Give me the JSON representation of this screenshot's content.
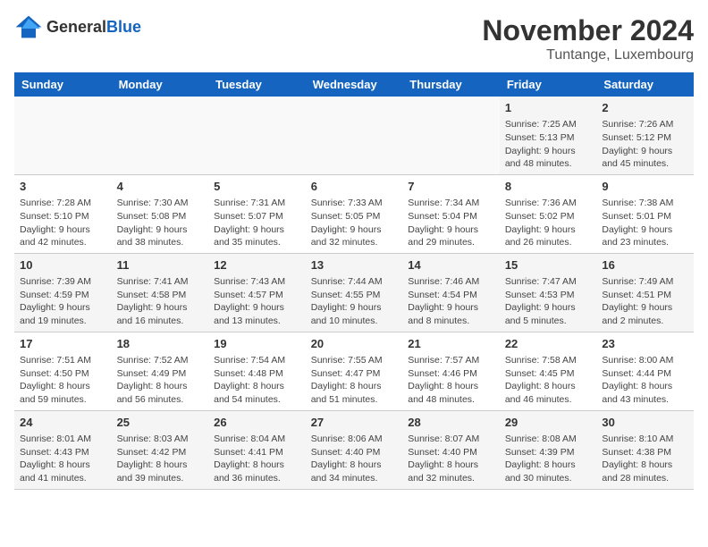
{
  "header": {
    "logo_general": "General",
    "logo_blue": "Blue",
    "month_title": "November 2024",
    "location": "Tuntange, Luxembourg"
  },
  "days_of_week": [
    "Sunday",
    "Monday",
    "Tuesday",
    "Wednesday",
    "Thursday",
    "Friday",
    "Saturday"
  ],
  "weeks": [
    [
      {
        "day": "",
        "sunrise": "",
        "sunset": "",
        "daylight": ""
      },
      {
        "day": "",
        "sunrise": "",
        "sunset": "",
        "daylight": ""
      },
      {
        "day": "",
        "sunrise": "",
        "sunset": "",
        "daylight": ""
      },
      {
        "day": "",
        "sunrise": "",
        "sunset": "",
        "daylight": ""
      },
      {
        "day": "",
        "sunrise": "",
        "sunset": "",
        "daylight": ""
      },
      {
        "day": "1",
        "sunrise": "Sunrise: 7:25 AM",
        "sunset": "Sunset: 5:13 PM",
        "daylight": "Daylight: 9 hours and 48 minutes."
      },
      {
        "day": "2",
        "sunrise": "Sunrise: 7:26 AM",
        "sunset": "Sunset: 5:12 PM",
        "daylight": "Daylight: 9 hours and 45 minutes."
      }
    ],
    [
      {
        "day": "3",
        "sunrise": "Sunrise: 7:28 AM",
        "sunset": "Sunset: 5:10 PM",
        "daylight": "Daylight: 9 hours and 42 minutes."
      },
      {
        "day": "4",
        "sunrise": "Sunrise: 7:30 AM",
        "sunset": "Sunset: 5:08 PM",
        "daylight": "Daylight: 9 hours and 38 minutes."
      },
      {
        "day": "5",
        "sunrise": "Sunrise: 7:31 AM",
        "sunset": "Sunset: 5:07 PM",
        "daylight": "Daylight: 9 hours and 35 minutes."
      },
      {
        "day": "6",
        "sunrise": "Sunrise: 7:33 AM",
        "sunset": "Sunset: 5:05 PM",
        "daylight": "Daylight: 9 hours and 32 minutes."
      },
      {
        "day": "7",
        "sunrise": "Sunrise: 7:34 AM",
        "sunset": "Sunset: 5:04 PM",
        "daylight": "Daylight: 9 hours and 29 minutes."
      },
      {
        "day": "8",
        "sunrise": "Sunrise: 7:36 AM",
        "sunset": "Sunset: 5:02 PM",
        "daylight": "Daylight: 9 hours and 26 minutes."
      },
      {
        "day": "9",
        "sunrise": "Sunrise: 7:38 AM",
        "sunset": "Sunset: 5:01 PM",
        "daylight": "Daylight: 9 hours and 23 minutes."
      }
    ],
    [
      {
        "day": "10",
        "sunrise": "Sunrise: 7:39 AM",
        "sunset": "Sunset: 4:59 PM",
        "daylight": "Daylight: 9 hours and 19 minutes."
      },
      {
        "day": "11",
        "sunrise": "Sunrise: 7:41 AM",
        "sunset": "Sunset: 4:58 PM",
        "daylight": "Daylight: 9 hours and 16 minutes."
      },
      {
        "day": "12",
        "sunrise": "Sunrise: 7:43 AM",
        "sunset": "Sunset: 4:57 PM",
        "daylight": "Daylight: 9 hours and 13 minutes."
      },
      {
        "day": "13",
        "sunrise": "Sunrise: 7:44 AM",
        "sunset": "Sunset: 4:55 PM",
        "daylight": "Daylight: 9 hours and 10 minutes."
      },
      {
        "day": "14",
        "sunrise": "Sunrise: 7:46 AM",
        "sunset": "Sunset: 4:54 PM",
        "daylight": "Daylight: 9 hours and 8 minutes."
      },
      {
        "day": "15",
        "sunrise": "Sunrise: 7:47 AM",
        "sunset": "Sunset: 4:53 PM",
        "daylight": "Daylight: 9 hours and 5 minutes."
      },
      {
        "day": "16",
        "sunrise": "Sunrise: 7:49 AM",
        "sunset": "Sunset: 4:51 PM",
        "daylight": "Daylight: 9 hours and 2 minutes."
      }
    ],
    [
      {
        "day": "17",
        "sunrise": "Sunrise: 7:51 AM",
        "sunset": "Sunset: 4:50 PM",
        "daylight": "Daylight: 8 hours and 59 minutes."
      },
      {
        "day": "18",
        "sunrise": "Sunrise: 7:52 AM",
        "sunset": "Sunset: 4:49 PM",
        "daylight": "Daylight: 8 hours and 56 minutes."
      },
      {
        "day": "19",
        "sunrise": "Sunrise: 7:54 AM",
        "sunset": "Sunset: 4:48 PM",
        "daylight": "Daylight: 8 hours and 54 minutes."
      },
      {
        "day": "20",
        "sunrise": "Sunrise: 7:55 AM",
        "sunset": "Sunset: 4:47 PM",
        "daylight": "Daylight: 8 hours and 51 minutes."
      },
      {
        "day": "21",
        "sunrise": "Sunrise: 7:57 AM",
        "sunset": "Sunset: 4:46 PM",
        "daylight": "Daylight: 8 hours and 48 minutes."
      },
      {
        "day": "22",
        "sunrise": "Sunrise: 7:58 AM",
        "sunset": "Sunset: 4:45 PM",
        "daylight": "Daylight: 8 hours and 46 minutes."
      },
      {
        "day": "23",
        "sunrise": "Sunrise: 8:00 AM",
        "sunset": "Sunset: 4:44 PM",
        "daylight": "Daylight: 8 hours and 43 minutes."
      }
    ],
    [
      {
        "day": "24",
        "sunrise": "Sunrise: 8:01 AM",
        "sunset": "Sunset: 4:43 PM",
        "daylight": "Daylight: 8 hours and 41 minutes."
      },
      {
        "day": "25",
        "sunrise": "Sunrise: 8:03 AM",
        "sunset": "Sunset: 4:42 PM",
        "daylight": "Daylight: 8 hours and 39 minutes."
      },
      {
        "day": "26",
        "sunrise": "Sunrise: 8:04 AM",
        "sunset": "Sunset: 4:41 PM",
        "daylight": "Daylight: 8 hours and 36 minutes."
      },
      {
        "day": "27",
        "sunrise": "Sunrise: 8:06 AM",
        "sunset": "Sunset: 4:40 PM",
        "daylight": "Daylight: 8 hours and 34 minutes."
      },
      {
        "day": "28",
        "sunrise": "Sunrise: 8:07 AM",
        "sunset": "Sunset: 4:40 PM",
        "daylight": "Daylight: 8 hours and 32 minutes."
      },
      {
        "day": "29",
        "sunrise": "Sunrise: 8:08 AM",
        "sunset": "Sunset: 4:39 PM",
        "daylight": "Daylight: 8 hours and 30 minutes."
      },
      {
        "day": "30",
        "sunrise": "Sunrise: 8:10 AM",
        "sunset": "Sunset: 4:38 PM",
        "daylight": "Daylight: 8 hours and 28 minutes."
      }
    ]
  ]
}
